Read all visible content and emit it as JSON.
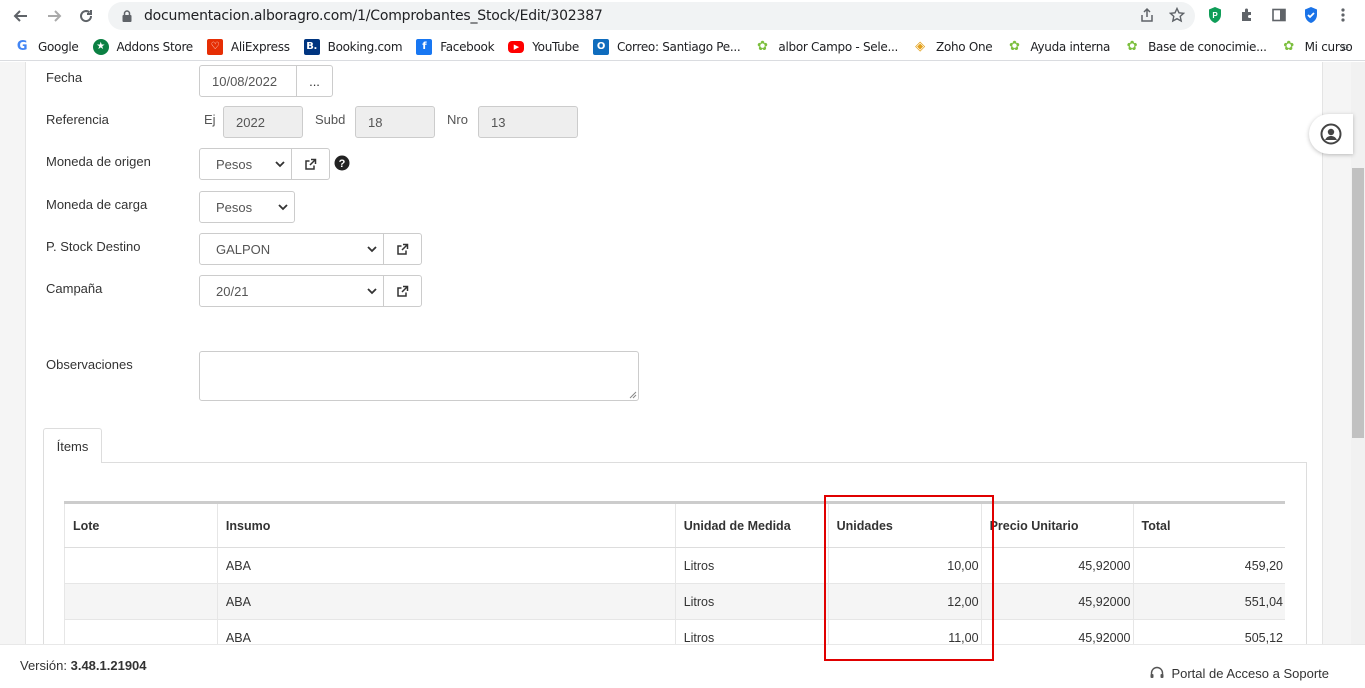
{
  "browser": {
    "url": "documentacion.alboragro.com/1/Comprobantes_Stock/Edit/302387",
    "bookmarks": [
      {
        "label": "Google",
        "icon": "google-icon",
        "color": "#4285f4"
      },
      {
        "label": "Addons Store",
        "icon": "addons-icon",
        "color": "#0b8043"
      },
      {
        "label": "AliExpress",
        "icon": "aliexpress-icon",
        "color": "#e62e04"
      },
      {
        "label": "Booking.com",
        "icon": "booking-icon",
        "color": "#003580"
      },
      {
        "label": "Facebook",
        "icon": "facebook-icon",
        "color": "#1877f2"
      },
      {
        "label": "YouTube",
        "icon": "youtube-icon",
        "color": "#ff0000"
      },
      {
        "label": "Correo: Santiago Pe...",
        "icon": "outlook-icon",
        "color": "#0f6cbd"
      },
      {
        "label": "albor Campo - Sele...",
        "icon": "albor-icon",
        "color": "#7cbf3e"
      },
      {
        "label": "Zoho One",
        "icon": "zoho-icon",
        "color": "#e4a11b"
      },
      {
        "label": "Ayuda interna",
        "icon": "albor-icon",
        "color": "#7cbf3e"
      },
      {
        "label": "Base de conocimie...",
        "icon": "albor-icon",
        "color": "#7cbf3e"
      },
      {
        "label": "Mi curso",
        "icon": "albor-icon",
        "color": "#7cbf3e"
      }
    ]
  },
  "form": {
    "fecha_label": "Fecha",
    "fecha_value": "10/08/2022",
    "fecha_btn": "...",
    "referencia_label": "Referencia",
    "ej_label": "Ej",
    "ej_value": "2022",
    "subd_label": "Subd",
    "subd_value": "18",
    "nro_label": "Nro",
    "nro_value": "13",
    "moneda_origen_label": "Moneda de origen",
    "moneda_origen_value": "Pesos",
    "moneda_carga_label": "Moneda de carga",
    "moneda_carga_value": "Pesos",
    "stock_destino_label": "P. Stock Destino",
    "stock_destino_value": "GALPON",
    "campana_label": "Campaña",
    "campana_value": "20/21",
    "observaciones_label": "Observaciones"
  },
  "tabs": {
    "items_label": "Ítems"
  },
  "table": {
    "headers": [
      "Lote",
      "Insumo",
      "Unidad de Medida",
      "Unidades",
      "Precio Unitario",
      "Total"
    ],
    "rows": [
      [
        "",
        "ABA",
        "Litros",
        "10,00",
        "45,92000",
        "459,20"
      ],
      [
        "",
        "ABA",
        "Litros",
        "12,00",
        "45,92000",
        "551,04"
      ],
      [
        "",
        "ABA",
        "Litros",
        "11,00",
        "45,92000",
        "505,12"
      ]
    ]
  },
  "footer": {
    "version_label": "Versión:",
    "version_value": "3.48.1.21904",
    "support_label": "Portal de Acceso a Soporte"
  },
  "colors": {
    "highlight": "#e00000"
  }
}
